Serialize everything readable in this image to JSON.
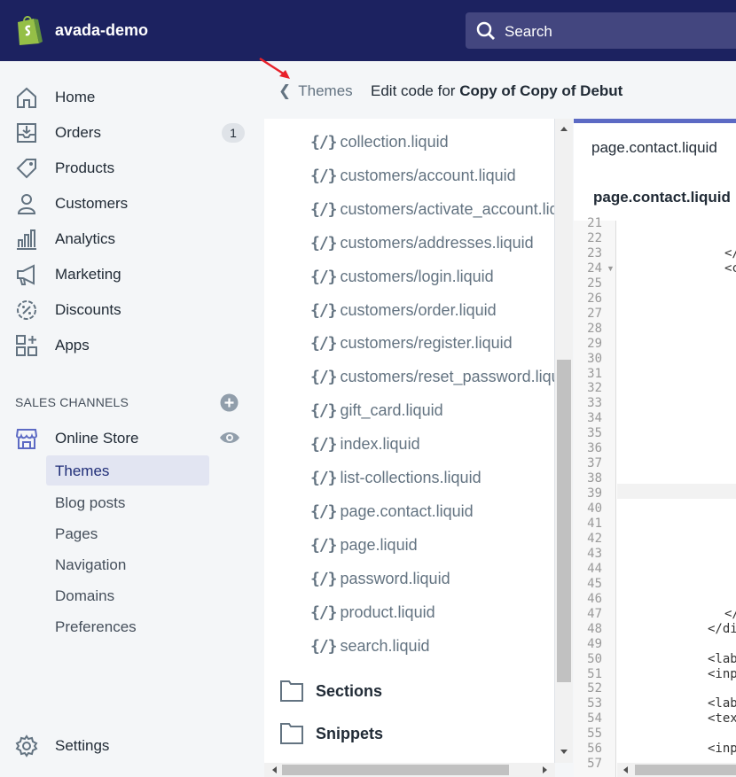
{
  "topbar": {
    "store_name": "avada-demo",
    "search_placeholder": "Search",
    "logo_icon": "shopify-bag-icon"
  },
  "sidebar": {
    "items": [
      {
        "label": "Home",
        "icon": "home-icon"
      },
      {
        "label": "Orders",
        "icon": "orders-icon",
        "badge": "1"
      },
      {
        "label": "Products",
        "icon": "tag-icon"
      },
      {
        "label": "Customers",
        "icon": "person-icon"
      },
      {
        "label": "Analytics",
        "icon": "bar-chart-icon"
      },
      {
        "label": "Marketing",
        "icon": "megaphone-icon"
      },
      {
        "label": "Discounts",
        "icon": "discount-icon"
      },
      {
        "label": "Apps",
        "icon": "apps-icon"
      }
    ],
    "sales_channels_title": "SALES CHANNELS",
    "online_store": "Online Store",
    "sub_items": [
      "Themes",
      "Blog posts",
      "Pages",
      "Navigation",
      "Domains",
      "Preferences"
    ],
    "settings": "Settings"
  },
  "header": {
    "back_label": "Themes",
    "edit_prefix": "Edit code for",
    "theme_name": "Copy of Copy of Debut"
  },
  "files": {
    "brace": "{/}",
    "templates": [
      "collection.liquid",
      "customers/account.liquid",
      "customers/activate_account.liquid",
      "customers/addresses.liquid",
      "customers/login.liquid",
      "customers/order.liquid",
      "customers/register.liquid",
      "customers/reset_password.liquid",
      "gift_card.liquid",
      "index.liquid",
      "list-collections.liquid",
      "page.contact.liquid",
      "page.liquid",
      "password.liquid",
      "product.liquid",
      "search.liquid"
    ],
    "folders": [
      "Sections",
      "Snippets"
    ]
  },
  "editor": {
    "tab_open": "page.contact.liquid",
    "tab_active": "page.contact.liquid",
    "line_numbers": [
      "21",
      "22",
      "23",
      "24",
      "25",
      "26",
      "27",
      "28",
      "29",
      "30",
      "31",
      "32",
      "33",
      "34",
      "35",
      "36",
      "37",
      "38",
      "39",
      "40",
      "41",
      "42",
      "43",
      "44",
      "45",
      "46",
      "47",
      "48",
      "49",
      "50",
      "51",
      "52",
      "53",
      "54",
      "55",
      "56",
      "57"
    ],
    "code_fragments": {
      "l23": "</",
      "l24": "<c",
      "l47": "</",
      "l48": "</di",
      "l50": "<lab",
      "l51": "<inp",
      "l53": "<lab",
      "l54": "<tex",
      "l56": "<inp"
    }
  }
}
